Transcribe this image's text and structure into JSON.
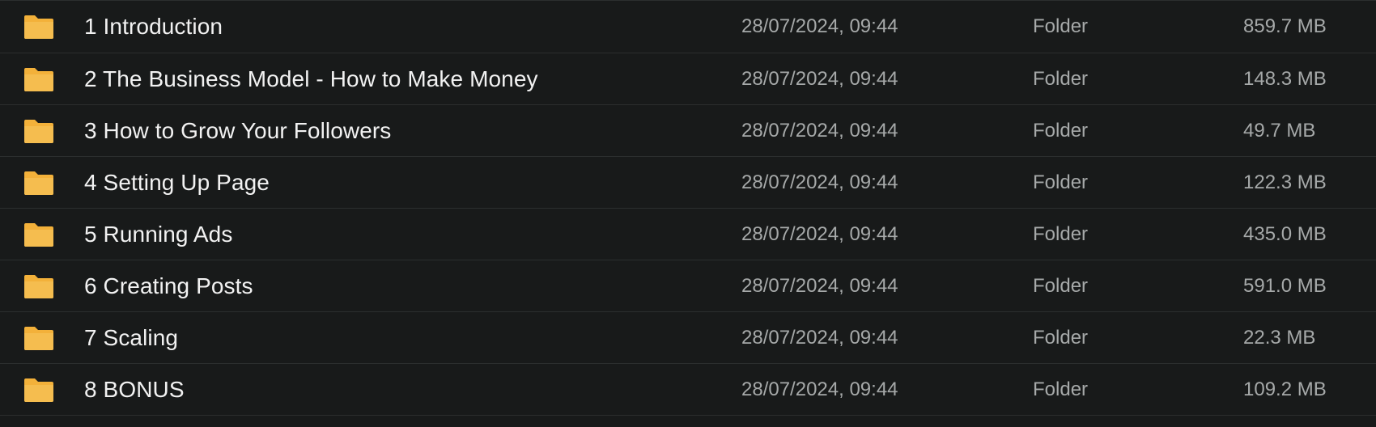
{
  "colors": {
    "background": "#181a1a",
    "row_divider": "#2b2e2e",
    "name_text": "#f2f2f2",
    "meta_text": "#a6a9a9",
    "folder_icon": "#f3b13a"
  },
  "rows": [
    {
      "icon": "folder-icon",
      "name": "1 Introduction",
      "date": "28/07/2024, 09:44",
      "kind": "Folder",
      "size": "859.7 MB"
    },
    {
      "icon": "folder-icon",
      "name": "2 The Business Model - How to Make Money",
      "date": "28/07/2024, 09:44",
      "kind": "Folder",
      "size": "148.3 MB"
    },
    {
      "icon": "folder-icon",
      "name": "3 How to Grow Your Followers",
      "date": "28/07/2024, 09:44",
      "kind": "Folder",
      "size": "49.7 MB"
    },
    {
      "icon": "folder-icon",
      "name": "4 Setting Up Page",
      "date": "28/07/2024, 09:44",
      "kind": "Folder",
      "size": "122.3 MB"
    },
    {
      "icon": "folder-icon",
      "name": "5 Running Ads",
      "date": "28/07/2024, 09:44",
      "kind": "Folder",
      "size": "435.0 MB"
    },
    {
      "icon": "folder-icon",
      "name": "6 Creating Posts",
      "date": "28/07/2024, 09:44",
      "kind": "Folder",
      "size": "591.0 MB"
    },
    {
      "icon": "folder-icon",
      "name": "7 Scaling",
      "date": "28/07/2024, 09:44",
      "kind": "Folder",
      "size": "22.3 MB"
    },
    {
      "icon": "folder-icon",
      "name": "8 BONUS",
      "date": "28/07/2024, 09:44",
      "kind": "Folder",
      "size": "109.2 MB"
    }
  ]
}
